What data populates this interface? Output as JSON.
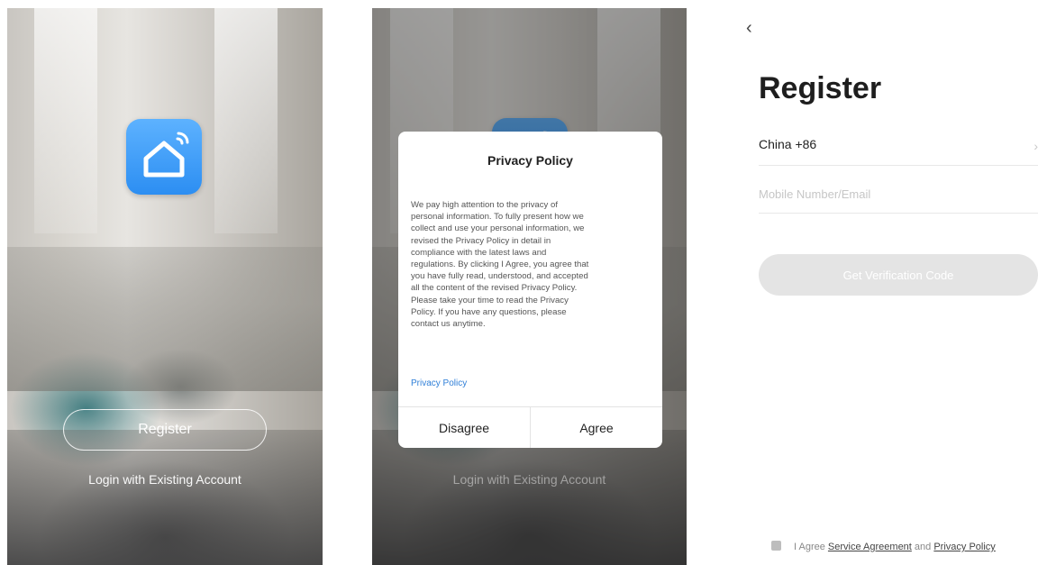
{
  "screen1": {
    "app_icon": "smart-home-icon",
    "register_label": "Register",
    "login_label": "Login with Existing Account"
  },
  "screen2": {
    "dialog": {
      "title": "Privacy Policy",
      "body_lines": [
        "We pay high attention to the privacy of",
        "personal information. To fully present how we",
        "collect and use your personal information, we",
        "revised the Privacy Policy in detail in",
        "compliance with the latest laws and",
        "regulations. By clicking I Agree, you agree that",
        "you have fully read, understood, and accepted",
        "all the content of the revised Privacy Policy.",
        "Please take your time to read the Privacy",
        "Policy. If you have any questions, please",
        "contact us anytime."
      ],
      "link_label": "Privacy Policy",
      "disagree_label": "Disagree",
      "agree_label": "Agree"
    },
    "login_label": "Login with Existing Account"
  },
  "screen3": {
    "back_icon": "chevron-left-icon",
    "title": "Register",
    "country": "China +86",
    "mobile_placeholder": "Mobile Number/Email",
    "mobile_value": "",
    "verify_label": "Get Verification Code",
    "agree_prefix": "I Agree",
    "service_agreement": "Service Agreement",
    "and": "and",
    "privacy_policy": "Privacy Policy"
  },
  "colors": {
    "accent_blue": "#2c8ef2",
    "link_blue": "#2f7fd8",
    "button_disabled": "#e4e4e4"
  }
}
